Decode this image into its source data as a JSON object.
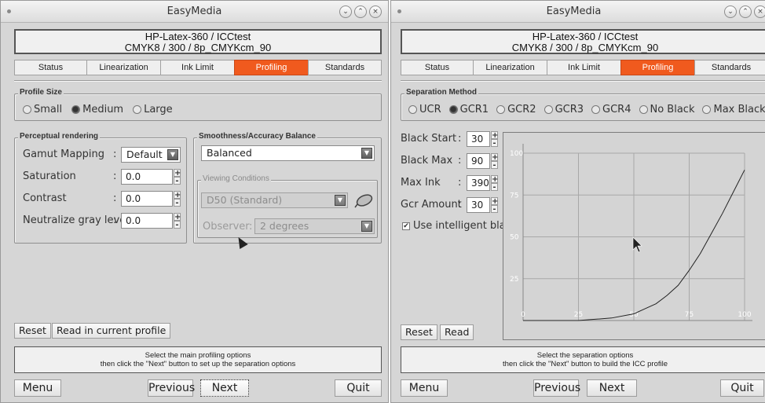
{
  "app_title": "EasyMedia",
  "header": {
    "line1": "HP-Latex-360 / ICCtest",
    "line2": "CMYK8 / 300 / 8p_CMYKcm_90"
  },
  "tabs": [
    "Status",
    "Linearization",
    "Ink Limit",
    "Profiling",
    "Standards"
  ],
  "active_tab": "Profiling",
  "accent_color": "#f05a1e",
  "left": {
    "profile_size": {
      "title": "Profile Size",
      "options": [
        "Small",
        "Medium",
        "Large"
      ],
      "selected": "Medium"
    },
    "perceptual": {
      "title": "Perceptual rendering",
      "gamut_mapping": {
        "label": "Gamut Mapping",
        "value": "Default"
      },
      "saturation": {
        "label": "Saturation",
        "value": "0.0"
      },
      "contrast": {
        "label": "Contrast",
        "value": "0.0"
      },
      "neutralize": {
        "label": "Neutralize gray level",
        "value": "0.0"
      }
    },
    "smoothness": {
      "title": "Smoothness/Accuracy Balance",
      "value": "Balanced"
    },
    "viewing": {
      "title": "Viewing Conditions",
      "illuminant": "D50 (Standard)",
      "observer_label": "Observer",
      "observer_value": "2 degrees"
    },
    "reset_label": "Reset",
    "read_label": "Read in current profile",
    "status_line1": "Select the main profiling options",
    "status_line2": "then click the \"Next\" button to set up the separation options"
  },
  "right": {
    "separation": {
      "title": "Separation Method",
      "options": [
        "UCR",
        "GCR1",
        "GCR2",
        "GCR3",
        "GCR4",
        "No Black",
        "Max Black"
      ],
      "selected": "GCR1"
    },
    "fields": [
      {
        "label": "Black Start",
        "value": "30"
      },
      {
        "label": "Black Max",
        "value": "90"
      },
      {
        "label": "Max Ink",
        "value": "390"
      },
      {
        "label": "Gcr Amount",
        "value": "30"
      }
    ],
    "intelligent_black": {
      "label": "Use intelligent black",
      "checked": true
    },
    "reset_label": "Reset",
    "read_label": "Read",
    "status_line1": "Select the separation options",
    "status_line2": "then click the \"Next\" button to build the ICC profile"
  },
  "nav": {
    "menu": "Menu",
    "previous": "Previous",
    "next": "Next",
    "quit": "Quit"
  },
  "chart_data": {
    "type": "line",
    "x_ticks": [
      "0",
      "25",
      "50",
      "75",
      "100"
    ],
    "y_ticks": [
      "25",
      "50",
      "75",
      "100"
    ],
    "xlim": [
      0,
      100
    ],
    "ylim": [
      0,
      100
    ],
    "grid": true,
    "series": [
      {
        "x": [
          0,
          25,
          30,
          40,
          50,
          55,
          60,
          65,
          70,
          75,
          80,
          85,
          90,
          95,
          100
        ],
        "y": [
          0,
          0,
          0.5,
          1.5,
          4,
          7,
          10,
          15,
          21,
          30,
          40,
          52,
          64,
          77,
          90
        ]
      }
    ]
  }
}
